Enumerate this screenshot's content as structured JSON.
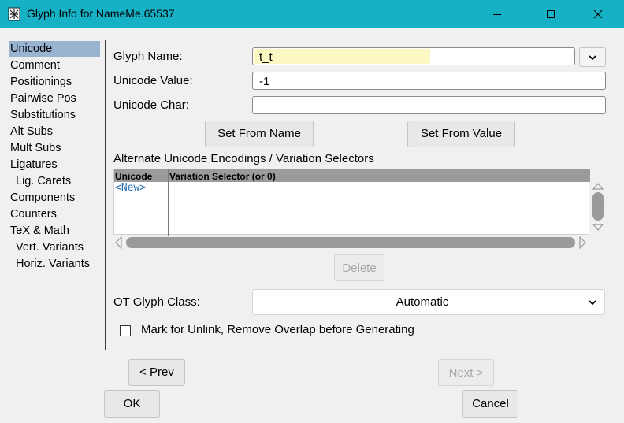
{
  "window": {
    "title": "Glyph Info for NameMe.65537"
  },
  "sidebar": {
    "items": [
      {
        "label": "Unicode"
      },
      {
        "label": "Comment"
      },
      {
        "label": "Positionings"
      },
      {
        "label": "Pairwise Pos"
      },
      {
        "label": "Substitutions"
      },
      {
        "label": "Alt Subs"
      },
      {
        "label": "Mult Subs"
      },
      {
        "label": "Ligatures"
      },
      {
        "label": "Lig. Carets"
      },
      {
        "label": "Components"
      },
      {
        "label": "Counters"
      },
      {
        "label": "TeX & Math"
      },
      {
        "label": "Vert. Variants"
      },
      {
        "label": "Horiz. Variants"
      }
    ],
    "selected": "Unicode"
  },
  "form": {
    "glyph_name_label": "Glyph Name:",
    "glyph_name_value": "t_t",
    "unicode_value_label": "Unicode Value:",
    "unicode_value_value": "-1",
    "unicode_char_label": "Unicode Char:",
    "unicode_char_value": "",
    "set_from_name": "Set From Name",
    "set_from_value": "Set From Value",
    "alt_encodings_label": "Alternate Unicode Encodings / Variation Selectors",
    "table": {
      "columns": [
        "Unicode",
        "Variation Selector (or 0)"
      ],
      "rows": [
        [
          "<New>",
          ""
        ]
      ]
    },
    "delete_button": "Delete",
    "ot_glyph_class_label": "OT Glyph Class:",
    "ot_glyph_class_value": "Automatic",
    "mark_unlink_label": "Mark for Unlink, Remove Overlap before Generating",
    "mark_unlink_checked": false
  },
  "footer": {
    "prev_button": "< Prev",
    "next_button": "Next >",
    "ok_button": "OK",
    "cancel_button": "Cancel"
  },
  "colors": {
    "titlebar": "#17b1c6",
    "selection": "#99b4d1",
    "name_highlight": "#fbf8c4"
  }
}
